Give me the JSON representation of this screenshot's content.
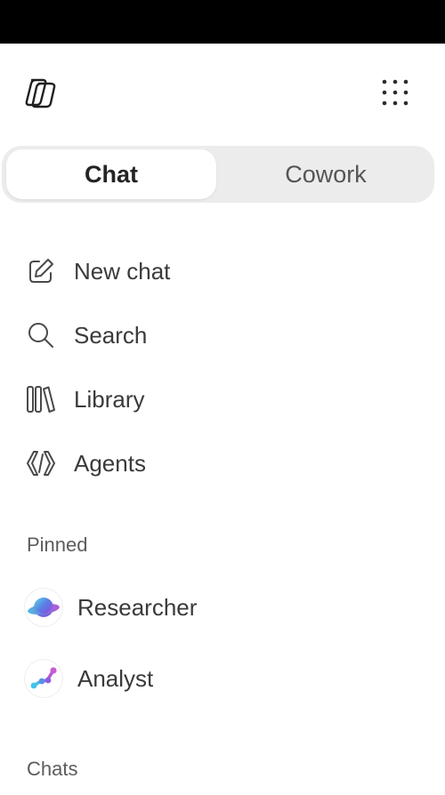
{
  "header": {
    "logo_icon": "copilot-logo-icon",
    "apps_icon": "app-launcher-grid-icon"
  },
  "mode_switch": {
    "tabs": [
      {
        "label": "Chat",
        "active": true
      },
      {
        "label": "Cowork",
        "active": false
      }
    ]
  },
  "nav": {
    "items": [
      {
        "label": "New chat",
        "icon": "compose-icon"
      },
      {
        "label": "Search",
        "icon": "search-icon"
      },
      {
        "label": "Library",
        "icon": "library-icon"
      },
      {
        "label": "Agents",
        "icon": "agents-icon"
      }
    ]
  },
  "pinned": {
    "header": "Pinned",
    "items": [
      {
        "label": "Researcher",
        "icon": "researcher-agent-icon"
      },
      {
        "label": "Analyst",
        "icon": "analyst-agent-icon"
      }
    ]
  },
  "chats": {
    "header": "Chats"
  },
  "colors": {
    "status_bar": "#000000",
    "segment_bg": "#ececec",
    "text_primary": "#242424",
    "text_secondary": "#5c5c5c"
  }
}
